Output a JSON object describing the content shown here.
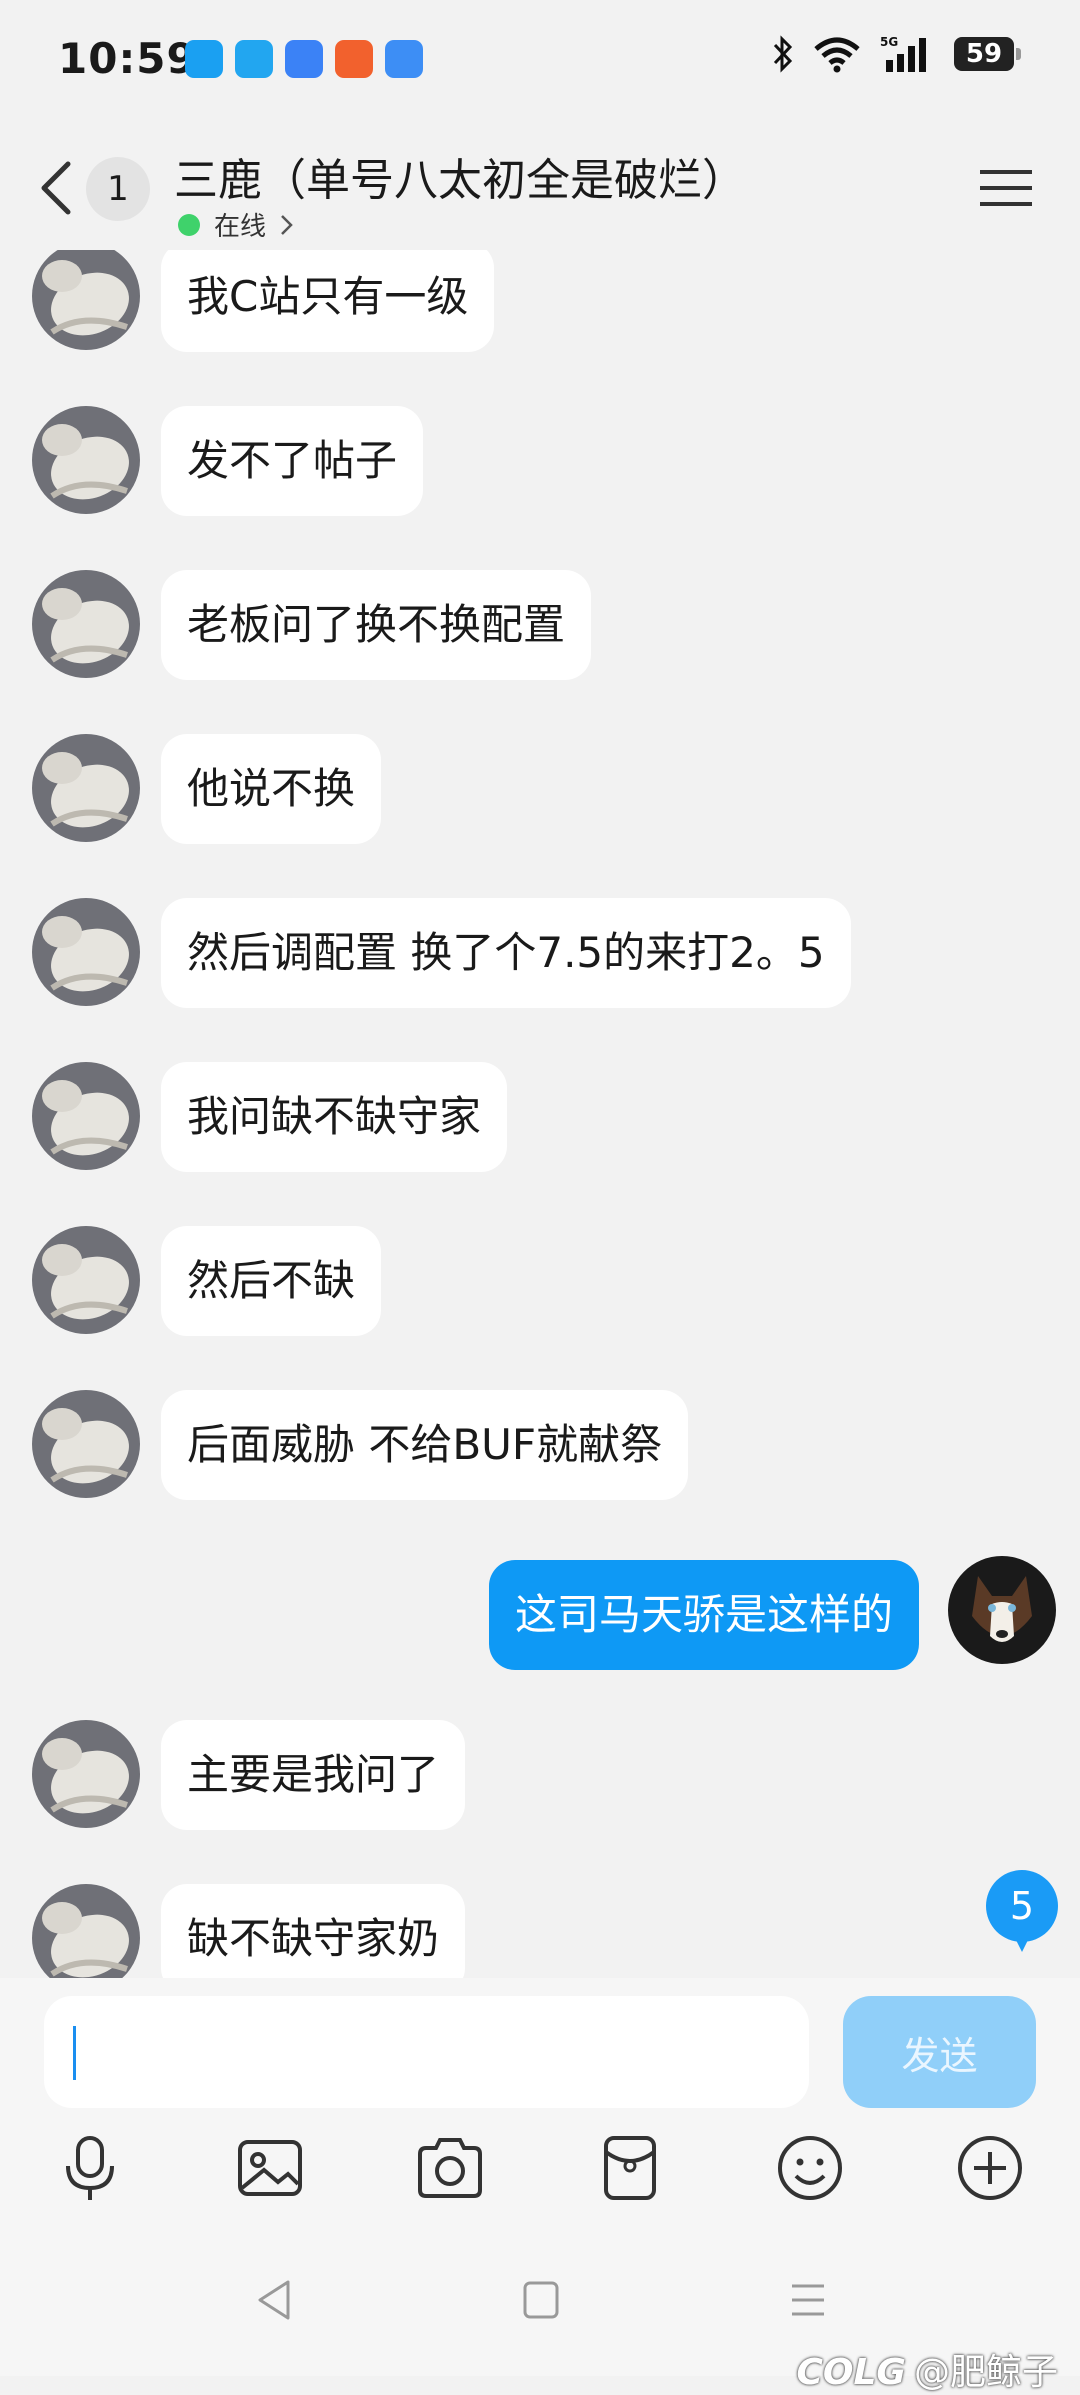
{
  "status_bar": {
    "time": "10:59",
    "battery": "59",
    "signal_label": "5G"
  },
  "header": {
    "unread_count": "1",
    "title": "三鹿（单号八太初全是破烂）",
    "online_status": "在线"
  },
  "messages": [
    {
      "side": "left",
      "text": "我C站只有一级"
    },
    {
      "side": "left",
      "text": "发不了帖子"
    },
    {
      "side": "left",
      "text": "老板问了换不换配置"
    },
    {
      "side": "left",
      "text": "他说不换"
    },
    {
      "side": "left",
      "text": "然后调配置 换了个7.5的来打2。5"
    },
    {
      "side": "left",
      "text": "我问缺不缺守家"
    },
    {
      "side": "left",
      "text": "然后不缺"
    },
    {
      "side": "left",
      "text": "后面威胁 不给BUF就献祭"
    },
    {
      "side": "right",
      "text": "这司马天骄是这样的"
    },
    {
      "side": "left",
      "text": "主要是我问了"
    },
    {
      "side": "left",
      "text": "缺不缺守家奶"
    }
  ],
  "new_message_badge": "5",
  "composer": {
    "input_value": "",
    "input_placeholder": "",
    "send_label": "发送"
  },
  "toolbar_icons": [
    "microphone-icon",
    "image-icon",
    "camera-icon",
    "red-packet-icon",
    "emoji-icon",
    "plus-icon"
  ],
  "watermark": "@肥鲸子",
  "watermark_logo": "COLG",
  "colors": {
    "my_bubble": "#0e99f5",
    "other_bubble": "#ffffff",
    "send_button": "#90cff9",
    "online_dot": "#3fd26b"
  }
}
